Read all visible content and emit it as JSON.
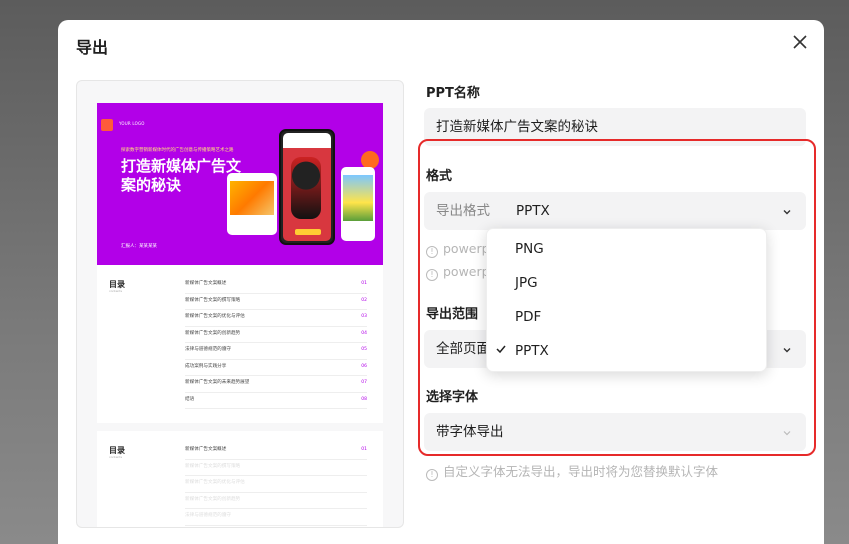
{
  "dialog": {
    "title": "导出",
    "close_icon": "close-icon"
  },
  "preview": {
    "cover": {
      "logo_text": "YOUR LOGO",
      "subtitle": "探索数字营销新媒体时代的广告创意与传播策略艺术之路",
      "title": "打造新媒体广告文案的秘诀",
      "author": "汇报人：某某某某"
    },
    "toc1": {
      "heading": "目录",
      "sub": "contents",
      "items": [
        {
          "label": "新媒体广告文案概述",
          "num": "01"
        },
        {
          "label": "新媒体广告文案的撰写策略",
          "num": "02"
        },
        {
          "label": "新媒体广告文案的优化与评估",
          "num": "03"
        },
        {
          "label": "新媒体广告文案的创新趋势",
          "num": "04"
        },
        {
          "label": "法律与道德规范的遵守",
          "num": "05"
        },
        {
          "label": "成功案例与实践分享",
          "num": "06"
        },
        {
          "label": "新媒体广告文案的未来趋势展望",
          "num": "07"
        },
        {
          "label": "结语",
          "num": "08"
        }
      ]
    },
    "toc2": {
      "heading": "目录",
      "sub": "contents",
      "items": [
        {
          "label": "新媒体广告文案概述",
          "num": "01"
        },
        {
          "label": "新媒体广告文案的撰写策略",
          "num": ""
        },
        {
          "label": "新媒体广告文案的优化与评估",
          "num": ""
        },
        {
          "label": "新媒体广告文案的创新趋势",
          "num": ""
        },
        {
          "label": "法律与道德规范的遵守",
          "num": ""
        }
      ]
    }
  },
  "form": {
    "ppt_name_label": "PPT名称",
    "ppt_name_value": "打造新媒体广告文案的秘诀",
    "format_label": "格式",
    "format_prefix": "导出格式",
    "format_value": "PPTX",
    "hint1": "powerp",
    "hint2": "powerp",
    "range_label": "导出范围",
    "range_value": "全部页面",
    "font_label": "选择字体",
    "font_value": "带字体导出",
    "font_hint": "自定义字体无法导出，导出时将为您替换默认字体"
  },
  "format_dropdown": {
    "options": [
      "PNG",
      "JPG",
      "PDF",
      "PPTX"
    ],
    "selected": "PPTX"
  },
  "colors": {
    "accent_red": "#e62a2a",
    "slide_purple": "#b200e8"
  }
}
